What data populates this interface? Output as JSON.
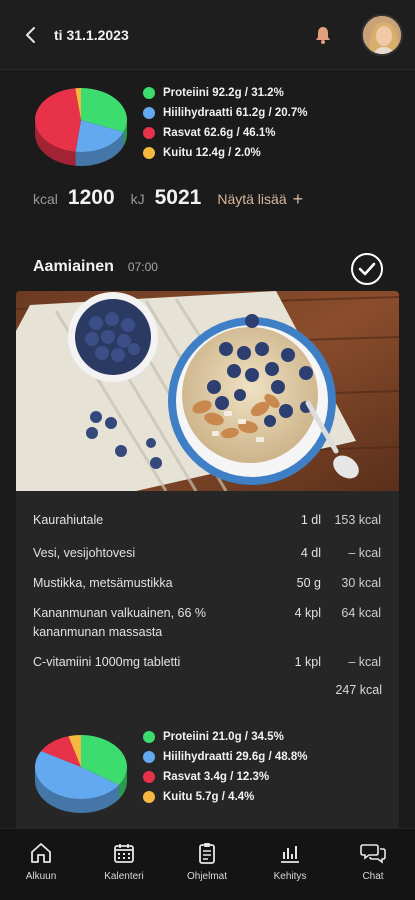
{
  "header": {
    "date": "ti 31.1.2023",
    "back_icon": "chevron-left-icon",
    "bell_icon": "bell-icon"
  },
  "day_summary": {
    "macros": [
      {
        "label": "Proteiini 92.2g / 31.2%",
        "color": "#3ddc6e",
        "fraction": 0.312
      },
      {
        "label": "Hiilihydraatti 61.2g / 20.7%",
        "color": "#63a9f0",
        "fraction": 0.207
      },
      {
        "label": "Rasvat 62.6g / 46.1%",
        "color": "#e8324a",
        "fraction": 0.461
      },
      {
        "label": "Kuitu 12.4g / 2.0%",
        "color": "#f5b941",
        "fraction": 0.02
      }
    ],
    "kcal_label": "kcal",
    "kcal_value": "1200",
    "kj_label": "kJ",
    "kj_value": "5021",
    "show_more": "Näytä lisää",
    "show_more_icon": "+"
  },
  "meal": {
    "title": "Aamiainen",
    "time": "07:00",
    "checked": true,
    "items": [
      {
        "name": "Kaurahiutale",
        "qty": "1 dl",
        "kcal": "153 kcal"
      },
      {
        "name": "Vesi, vesijohtovesi",
        "qty": "4 dl",
        "kcal": "– kcal"
      },
      {
        "name": "Mustikka, metsämustikka",
        "qty": "50 g",
        "kcal": "30 kcal"
      },
      {
        "name": "Kananmunan valkuainen, 66 % kananmunan massasta",
        "qty": "4 kpl",
        "kcal": "64 kcal"
      },
      {
        "name": "C-vitamiini 1000mg tabletti",
        "qty": "1 kpl",
        "kcal": "– kcal"
      }
    ],
    "total": "247 kcal",
    "macros": [
      {
        "label": "Proteiini 21.0g / 34.5%",
        "color": "#3ddc6e",
        "fraction": 0.345
      },
      {
        "label": "Hiilihydraatti 29.6g / 48.8%",
        "color": "#63a9f0",
        "fraction": 0.488
      },
      {
        "label": "Rasvat 3.4g / 12.3%",
        "color": "#e8324a",
        "fraction": 0.123
      },
      {
        "label": "Kuitu 5.7g / 4.4%",
        "color": "#f5b941",
        "fraction": 0.044
      }
    ]
  },
  "tabs": [
    {
      "label": "Alkuun",
      "icon": "home-icon"
    },
    {
      "label": "Kalenteri",
      "icon": "calendar-icon"
    },
    {
      "label": "Ohjelmat",
      "icon": "clipboard-icon"
    },
    {
      "label": "Kehitys",
      "icon": "bar-chart-icon"
    },
    {
      "label": "Chat",
      "icon": "chat-icon"
    }
  ]
}
